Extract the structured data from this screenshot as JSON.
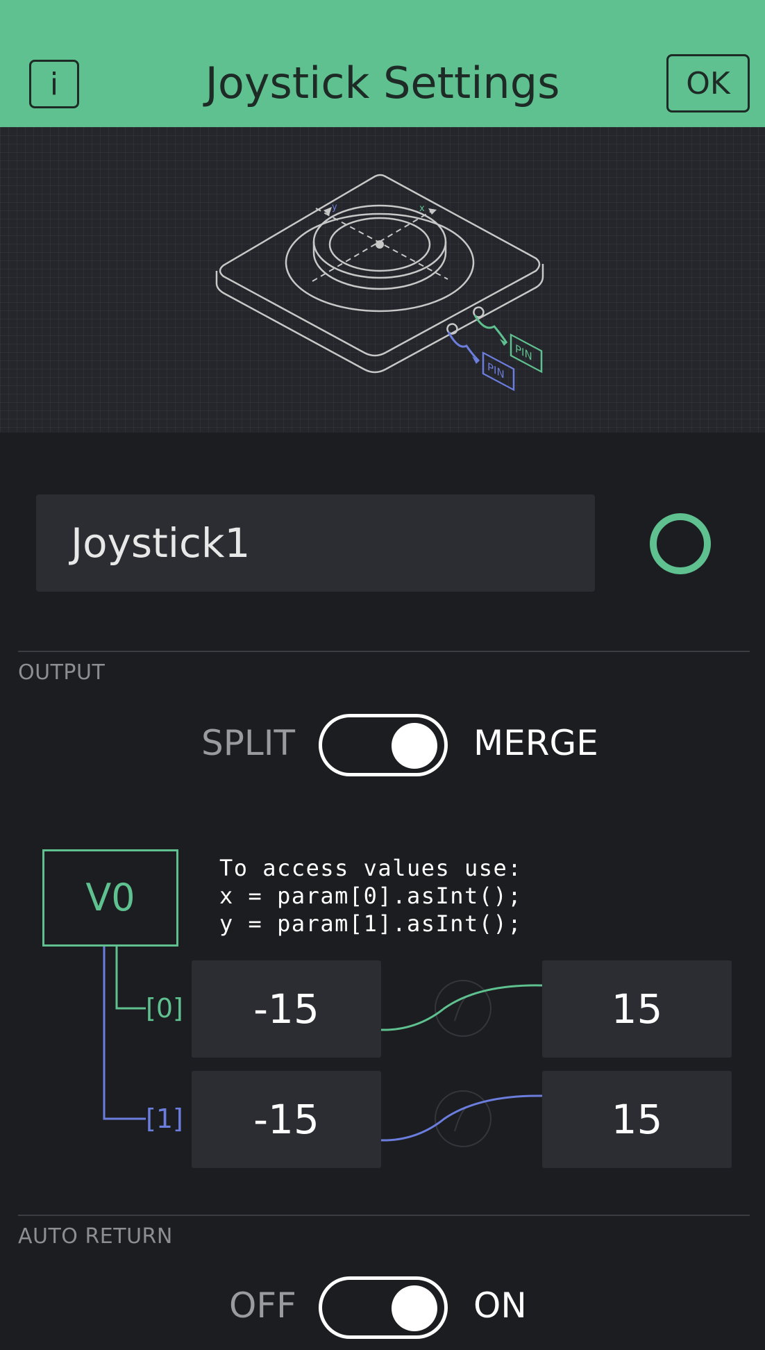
{
  "header": {
    "title": "Joystick Settings",
    "info_label": "i",
    "ok_label": "OK",
    "background": "#5ec18f"
  },
  "preview": {
    "pin_label_1": "PIN",
    "pin_label_2": "PIN",
    "axis_x_label": "x",
    "axis_y_label": "y"
  },
  "widget": {
    "name": "Joystick1",
    "color": "#5ec18f"
  },
  "output": {
    "section_label": "OUTPUT",
    "mode_left": "SPLIT",
    "mode_right": "MERGE",
    "mode_selected": "MERGE",
    "pin": "V0",
    "help_lines": [
      "To access values use:",
      "x = param[0].asInt();",
      "y = param[1].asInt();"
    ],
    "params": [
      {
        "index": "[0]",
        "min": "-15",
        "max": "15",
        "color": "#5ec18f"
      },
      {
        "index": "[1]",
        "min": "-15",
        "max": "15",
        "color": "#6b7ddd"
      }
    ]
  },
  "auto_return": {
    "section_label": "AUTO RETURN",
    "off_label": "OFF",
    "on_label": "ON",
    "value": "ON"
  }
}
